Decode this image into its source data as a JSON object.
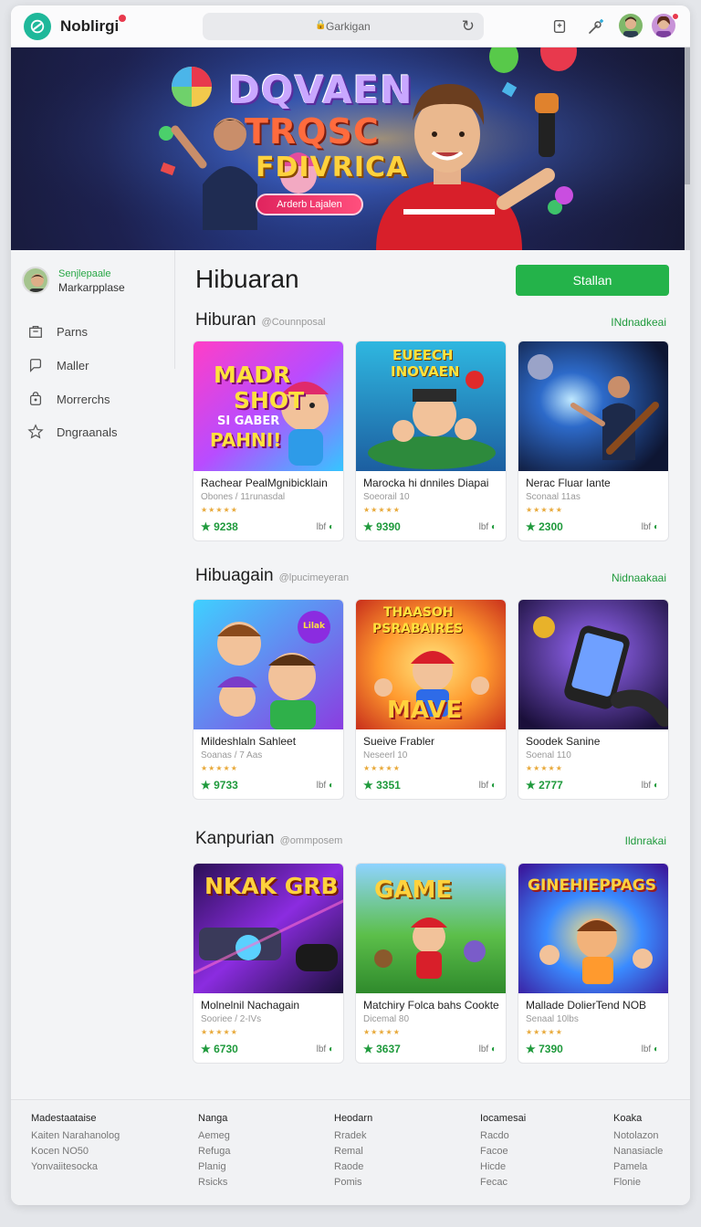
{
  "header": {
    "brand": "Noblirgi",
    "url": "Garkigan",
    "icons": [
      "bookmark-icon",
      "magic-plus-icon"
    ]
  },
  "hero": {
    "line1": "DQVAEN",
    "line2": "TRQSC",
    "line3": "FDIVRICA",
    "cta": "Arderb Lajalen"
  },
  "sidebar": {
    "profile_name": "Senjlepaale",
    "profile_sub": "Markarpplase",
    "items": [
      {
        "label": "Parns",
        "icon": "store-icon"
      },
      {
        "label": "Maller",
        "icon": "chat-bubble-icon"
      },
      {
        "label": "Morrerchs",
        "icon": "bag-icon"
      },
      {
        "label": "Dngraanals",
        "icon": "star-icon"
      }
    ]
  },
  "main": {
    "title": "Hibuaran",
    "primary_button": "Stallan",
    "sections": [
      {
        "title": "Hiburan",
        "tag": "@Counnposal",
        "link": "INdnadkeai",
        "cards": [
          {
            "img_text1": "MADR",
            "img_text2": "SHOT",
            "img_text3": "SI GABER",
            "img_text4": "PAHNI!",
            "title": "Rachear PealMgnibicklain",
            "sub": "Obones / 11runasdal",
            "price": "9238",
            "meta": "lbf"
          },
          {
            "img_text1": "EUEECH",
            "img_text2": "INOVAEN",
            "title": "Marocka hi dnniles Diapai",
            "sub": "Soeorail 10",
            "price": "9390",
            "meta": "lbf"
          },
          {
            "title": "Nerac Fluar Iante",
            "sub": "Sconaal 11as",
            "price": "2300",
            "meta": "lbf"
          }
        ]
      },
      {
        "title": "Hibuagain",
        "tag": "@lpucimeyeran",
        "link": "Nidnaakaai",
        "cards": [
          {
            "img_text1": "Lilak",
            "title": "Mildeshlaln Sahleet",
            "sub": "Soanas / 7 Aas",
            "price": "9733",
            "meta": "lbf"
          },
          {
            "img_text1": "THAASOH",
            "img_text2": "PSRABAIRES",
            "img_text3": "MAVE",
            "title": "Sueive Frabler",
            "sub": "Neseerl 10",
            "price": "3351",
            "meta": "lbf"
          },
          {
            "title": "Soodek Sanine",
            "sub": "Soenal 110",
            "price": "2777",
            "meta": "lbf"
          }
        ]
      },
      {
        "title": "Kanpurian",
        "tag": "@ommposem",
        "link": "Ildnrakai",
        "cards": [
          {
            "img_text1": "NKAK GRB",
            "title": "Molnelnil Nachagain",
            "sub": "Sooriee / 2-IVs",
            "price": "6730",
            "meta": "lbf"
          },
          {
            "img_text1": "GAME",
            "title": "Matchiry Folca bahs Cookte",
            "sub": "Dicemal 80",
            "price": "3637",
            "meta": "lbf"
          },
          {
            "img_text1": "GINEHIEPPAGS",
            "title": "Mallade DolierTend NOB",
            "sub": "Senaal 10lbs",
            "price": "7390",
            "meta": "lbf"
          }
        ]
      }
    ]
  },
  "footer": {
    "columns": [
      {
        "head": "Madestaataise",
        "links": [
          "Kaiten Narahanolog",
          "Kocen NO50",
          "Yonvaiitesocka"
        ]
      },
      {
        "head": "Nanga",
        "links": [
          "Aemeg",
          "Refuga",
          "Planig",
          "Rsicks"
        ]
      },
      {
        "head": "Heodarn",
        "links": [
          "Rradek",
          "Remal",
          "Raode",
          "Pomis"
        ]
      },
      {
        "head": "Iocamesai",
        "links": [
          "Racdo",
          "Facoe",
          "Hicde",
          "Fecac"
        ]
      },
      {
        "head": "Koaka",
        "links": [
          "Notolazon",
          "Nanasiacle",
          "Pamela",
          "Flonie"
        ]
      }
    ]
  },
  "colors": {
    "accent": "#24b34a",
    "brand": "#1fb89a",
    "link": "#1f9a3c",
    "star": "#e8a93a"
  }
}
